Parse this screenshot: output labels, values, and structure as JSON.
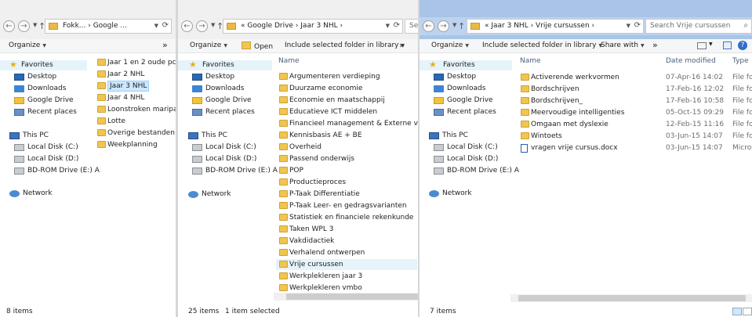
{
  "colors": {
    "active_title": "#a9c4e6",
    "inactive_title": "#f0f0f0",
    "selection": "#cce8ff",
    "hover": "#e5f3fb",
    "folder": "#f0c550"
  },
  "nav": {
    "favorites": "Favorites",
    "desktop": "Desktop",
    "downloads": "Downloads",
    "google_drive": "Google Drive",
    "recent_places": "Recent places",
    "this_pc": "This PC",
    "local_c": "Local Disk (C:)",
    "local_d": "Local Disk (D:)",
    "bdrom": "BD-ROM Drive (E:) A",
    "network": "Network"
  },
  "w1": {
    "address": "Fokk...  ›  Google ...",
    "organize": "Organize",
    "folders": [
      "Jaar 1 en 2 oude pc",
      "Jaar 2 NHL",
      "Jaar 3 NHL",
      "Jaar 4 NHL",
      "Loonstroken maripaan",
      "Lotte",
      "Overige bestanden",
      "Weekplanning"
    ],
    "status_count": "8 items"
  },
  "w2": {
    "address": "«  Google Drive  ›  Jaar 3 NHL  ›",
    "search_ph": "Se",
    "organize": "Organize",
    "open": "Open",
    "include": "Include selected folder in library",
    "more": "»",
    "col_name": "Name",
    "folders": [
      "Argumenteren verdieping",
      "Duurzame economie",
      "Economie en maatschappij",
      "Educatieve ICT middelen",
      "Financieel management & Externe versla...",
      "Kennisbasis AE + BE",
      "Overheid",
      "Passend onderwijs",
      "POP",
      "Productieproces",
      "P-Taak Differentiatie",
      "P-Taak Leer- en gedragsvarianten",
      "Statistiek en financiele rekenkunde",
      "Taken WPL 3",
      "Vakdidactiek",
      "Verhalend ontwerpen",
      "Vrije cursussen",
      "Werkplekleren jaar 3",
      "Werkplekleren vmbo"
    ],
    "status_count": "25 items",
    "status_sel": "1 item selected"
  },
  "w3": {
    "address": "«  Jaar 3 NHL  ›  Vrije cursussen  ›",
    "search_ph": "Search Vrije cursussen",
    "organize": "Organize",
    "include": "Include selected folder in library",
    "share": "Share with",
    "more": "»",
    "col_name": "Name",
    "col_date": "Date modified",
    "col_type": "Type",
    "items": [
      {
        "name": "Activerende werkvormen",
        "date": "07-Apr-16 14:02",
        "type": "File fol",
        "icon": "folder"
      },
      {
        "name": "Bordschrijven",
        "date": "17-Feb-16 12:02",
        "type": "File fol",
        "icon": "folder"
      },
      {
        "name": "Bordschrijven_",
        "date": "17-Feb-16 10:58",
        "type": "File fol",
        "icon": "folder"
      },
      {
        "name": "Meervoudige intelligenties",
        "date": "05-Oct-15 09:29",
        "type": "File fol",
        "icon": "folder"
      },
      {
        "name": "Omgaan met dyslexie",
        "date": "12-Feb-15 11:16",
        "type": "File fol",
        "icon": "folder"
      },
      {
        "name": "Wintoets",
        "date": "03-Jun-15 14:07",
        "type": "File fol",
        "icon": "folder"
      },
      {
        "name": "vragen vrije cursus.docx",
        "date": "03-Jun-15 14:07",
        "type": "Micros",
        "icon": "word-doc"
      }
    ],
    "status_count": "7 items"
  }
}
